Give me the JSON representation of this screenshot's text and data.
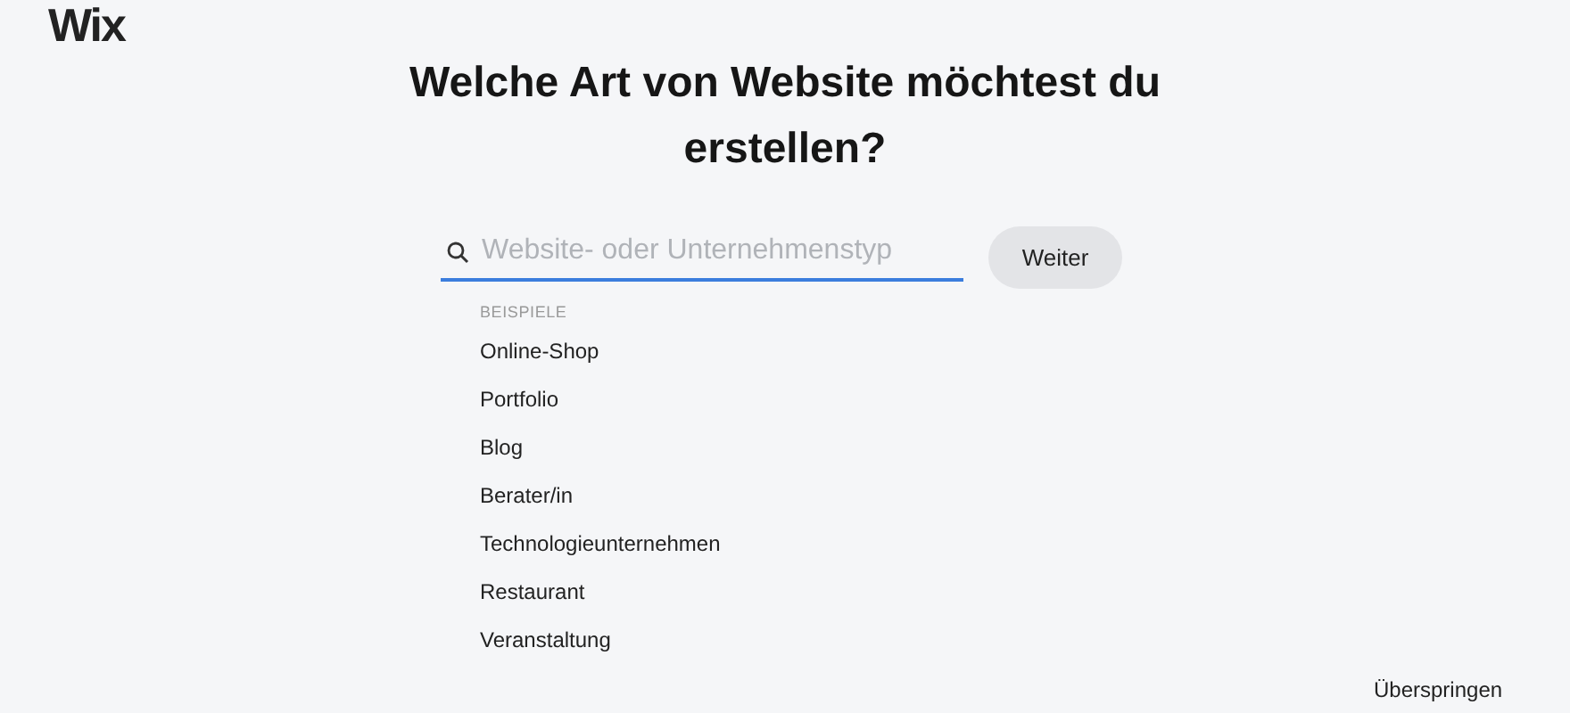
{
  "logo": "Wix",
  "heading": "Welche Art von Website möchtest du erstellen?",
  "search": {
    "placeholder": "Website- oder Unternehmenstyp"
  },
  "button": "Weiter",
  "examples": {
    "label": "BEISPIELE",
    "items": [
      "Online-Shop",
      "Portfolio",
      "Blog",
      "Berater/in",
      "Technologieunternehmen",
      "Restaurant",
      "Veranstaltung"
    ]
  },
  "skip_link": "Überspringen"
}
